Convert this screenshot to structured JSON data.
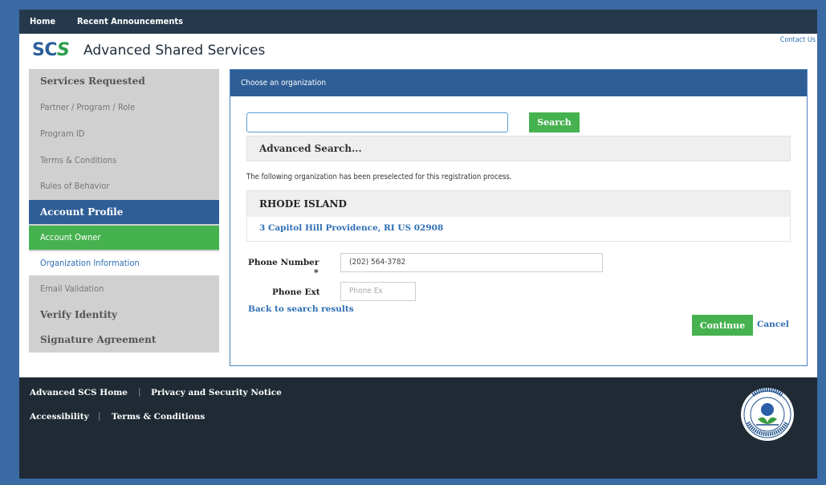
{
  "topnav": {
    "home": "Home",
    "announcements": "Recent Announcements"
  },
  "brand": {
    "logo_part1": "SC",
    "logo_part2": "S",
    "title": "Advanced Shared Services"
  },
  "contact": "Contact Us",
  "sidebar": {
    "items": [
      {
        "label": "Services Requested",
        "style": "head"
      },
      {
        "label": "Partner / Program / Role",
        "style": "normal"
      },
      {
        "label": "Program ID",
        "style": "normal"
      },
      {
        "label": "Terms & Conditions",
        "style": "normal"
      },
      {
        "label": "Rules of Behavior",
        "style": "normal"
      },
      {
        "label": "Account Profile",
        "style": "active"
      },
      {
        "label": "Account Owner",
        "style": "green"
      },
      {
        "label": "Organization Information",
        "style": "current"
      },
      {
        "label": "Email Validation",
        "style": "normal"
      },
      {
        "label": "Verify Identity",
        "style": "head"
      },
      {
        "label": "Signature Agreement",
        "style": "head"
      }
    ]
  },
  "panel": {
    "header": "Choose an organization",
    "search_button": "Search",
    "search_value": "",
    "advanced_search": "Advanced Search...",
    "note": "The following organization has been preselected for this registration process.",
    "org_name": "RHODE ISLAND",
    "org_address": "3 Capitol Hill Providence, RI US 02908",
    "phone_label": "Phone Number",
    "required_mark": "*",
    "phone_value": "(202) 564-3782",
    "ext_label": "Phone Ext",
    "ext_placeholder": "Phone Ex",
    "back_link": "Back to search results",
    "continue_button": "Continue",
    "cancel_link": "Cancel"
  },
  "footer": {
    "home": "Advanced SCS Home",
    "privacy": "Privacy and Security Notice",
    "accessibility": "Accessibility",
    "terms": "Terms & Conditions",
    "separator": "|"
  },
  "seal": {
    "text_top": "UNITED STATES",
    "text_bottom": "ENVIRONMENTAL PROTECTION AGENCY"
  },
  "colors": {
    "primary": "#2f5e97",
    "green": "#45b24f",
    "dark": "#26394c",
    "link": "#2f6fb5"
  }
}
